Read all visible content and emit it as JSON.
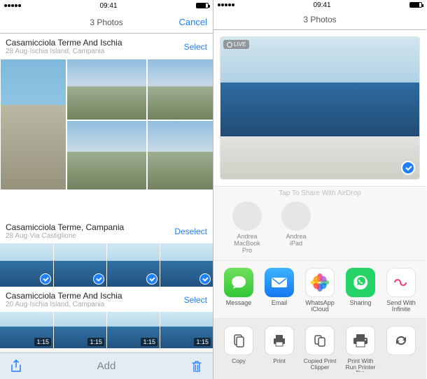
{
  "status": {
    "time": "09:41"
  },
  "left": {
    "nav": {
      "title": "3 Photos",
      "cancel": "Cancel"
    },
    "sections": [
      {
        "title": "Casamicciola Terme And Ischia",
        "subtitle": "28 Aug·Ischia Island, Campania",
        "action": "Select"
      },
      {
        "title": "Casamicciola Terme, Campania",
        "subtitle": "28 Aug·Via Castiglione",
        "action": "Deselect"
      },
      {
        "title": "Casamicciola Terme And Ischia",
        "subtitle": "20 Aug·Ischia Island, Campania",
        "action": "Select"
      }
    ],
    "video_durations": [
      "1:15",
      "1:15",
      "1:15",
      "1:15"
    ],
    "toolbar": {
      "center": "Add"
    }
  },
  "right": {
    "nav": {
      "title": "3 Photos"
    },
    "live_badge": "LIVE",
    "airdrop_hint": "Tap To Share With AirDrop",
    "airdrop": [
      {
        "name": "Andrea",
        "device": "MacBook Pro"
      },
      {
        "name": "Andrea",
        "device": "iPad"
      }
    ],
    "apps": [
      {
        "label": "Message"
      },
      {
        "label": "Email"
      },
      {
        "label": "WhatsApp iCloud Photos"
      },
      {
        "label": "Sharing"
      },
      {
        "label": "Send With Infinite"
      }
    ],
    "actions": [
      {
        "label": "Copy"
      },
      {
        "label": "Print"
      },
      {
        "label": "Copied Print Clipper"
      },
      {
        "label": "Print With Run Printer Pro Workflow"
      },
      {
        "label": ""
      }
    ]
  }
}
